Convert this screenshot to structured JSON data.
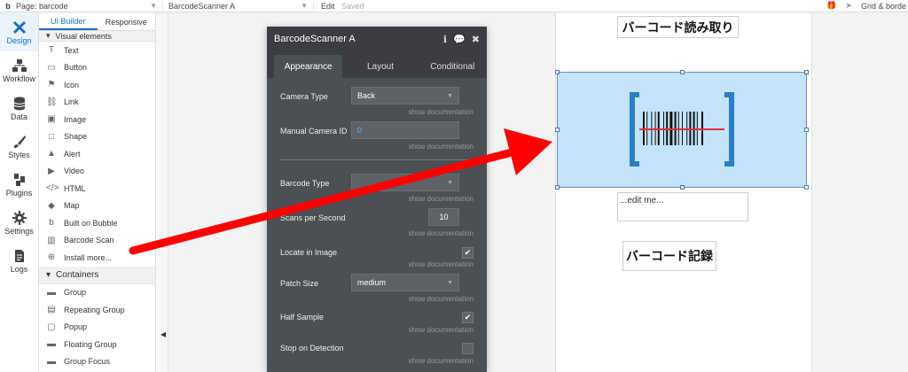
{
  "topbar": {
    "logo": "b",
    "page_label": "Page: barcode",
    "element_name": "BarcodeScanner A",
    "edit": "Edit",
    "saved": "Saved",
    "grid": "Grid & borde"
  },
  "rail": [
    {
      "label": "Design",
      "icon": "design-icon"
    },
    {
      "label": "Workflow",
      "icon": "workflow-icon"
    },
    {
      "label": "Data",
      "icon": "database-icon"
    },
    {
      "label": "Styles",
      "icon": "brush-icon"
    },
    {
      "label": "Plugins",
      "icon": "plug-icon"
    },
    {
      "label": "Settings",
      "icon": "gear-icon"
    },
    {
      "label": "Logs",
      "icon": "document-icon"
    }
  ],
  "palette": {
    "tabs": [
      "UI Builder",
      "Responsive"
    ],
    "section_visual": "Visual elements",
    "visual_items": [
      {
        "label": "Text",
        "icon": "T"
      },
      {
        "label": "Button",
        "icon": "▭"
      },
      {
        "label": "Icon",
        "icon": "⚑"
      },
      {
        "label": "Link",
        "icon": "⛓"
      },
      {
        "label": "Image",
        "icon": "▣"
      },
      {
        "label": "Shape",
        "icon": "□"
      },
      {
        "label": "Alert",
        "icon": "▲"
      },
      {
        "label": "Video",
        "icon": "▶"
      },
      {
        "label": "HTML",
        "icon": "</>"
      },
      {
        "label": "Map",
        "icon": "◆"
      },
      {
        "label": "Built on Bubble",
        "icon": "b"
      },
      {
        "label": "Barcode Scan",
        "icon": "▥"
      },
      {
        "label": "Install more...",
        "icon": "⊕"
      }
    ],
    "section_containers": "Containers",
    "container_items": [
      {
        "label": "Group",
        "icon": "▬"
      },
      {
        "label": "Repeating Group",
        "icon": "▤"
      },
      {
        "label": "Popup",
        "icon": "▢"
      },
      {
        "label": "Floating Group",
        "icon": "▬"
      },
      {
        "label": "Group Focus",
        "icon": "▬"
      }
    ]
  },
  "property_editor": {
    "title": "BarcodeScanner A",
    "tabs": [
      "Appearance",
      "Layout",
      "Conditional"
    ],
    "camera_type_label": "Camera Type",
    "camera_type_value": "Back",
    "manual_camera_label": "Manual Camera ID",
    "manual_camera_value": "0",
    "barcode_type_label": "Barcode Type",
    "scans_label": "Scans per Second",
    "scans_value": "10",
    "locate_label": "Locate in Image",
    "patch_label": "Patch Size",
    "patch_value": "medium",
    "half_label": "Half Sample",
    "stop_label": "Stop on Detection",
    "show_doc": "show documentation",
    "check": "✔"
  },
  "canvas": {
    "title_read": "バーコード読み取り",
    "edit_placeholder": "...edit me...",
    "title_record": "バーコード記録"
  },
  "colors": {
    "accent": "#1a6fc2",
    "scanner_bg": "#c3e3fb",
    "bracket": "#2c7fc0",
    "annotation_arrow": "#ff0000"
  }
}
